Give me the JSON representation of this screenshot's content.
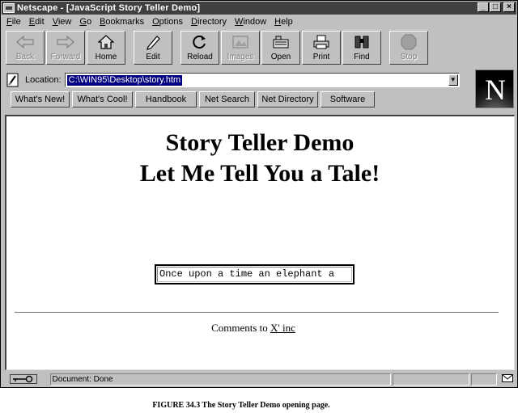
{
  "window": {
    "title": "Netscape - [JavaScript Story Teller Demo]"
  },
  "menu": [
    {
      "key": "F",
      "rest": "ile"
    },
    {
      "key": "E",
      "rest": "dit"
    },
    {
      "key": "V",
      "rest": "iew"
    },
    {
      "key": "G",
      "rest": "o"
    },
    {
      "key": "B",
      "rest": "ookmarks"
    },
    {
      "key": "O",
      "rest": "ptions"
    },
    {
      "key": "D",
      "rest": "irectory"
    },
    {
      "key": "W",
      "rest": "indow"
    },
    {
      "key": "H",
      "rest": "elp"
    }
  ],
  "toolbar": {
    "back": "Back",
    "forward": "Forward",
    "home": "Home",
    "edit": "Edit",
    "reload": "Reload",
    "images": "Images",
    "open": "Open",
    "print": "Print",
    "find": "Find",
    "stop": "Stop"
  },
  "location": {
    "label": "Location:",
    "url": "C:\\WIN95\\Desktop\\story.htm"
  },
  "directory_buttons": [
    "What's New!",
    "What's Cool!",
    "Handbook",
    "Net Search",
    "Net Directory",
    "Software"
  ],
  "logo": {
    "letter": "N"
  },
  "page": {
    "heading_line1": "Story Teller Demo",
    "heading_line2": "Let Me Tell You a Tale!",
    "story_text": "Once upon a time an elephant a",
    "comments_prefix": "Comments to",
    "comments_link": "X' inc"
  },
  "status": {
    "text": "Document: Done"
  },
  "caption": "FIGURE 34.3  The Story Teller Demo opening page.",
  "colors": {
    "titlebar": "#404040",
    "chrome": "#c0c0c0",
    "url_highlight": "#000080"
  }
}
